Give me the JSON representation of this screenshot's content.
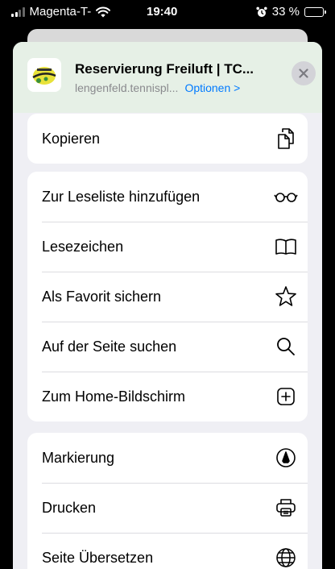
{
  "status_bar": {
    "carrier": "Magenta-T-",
    "time": "19:40",
    "battery": "33 %",
    "battery_level": 0.33
  },
  "share_sheet": {
    "title": "Reservierung Freiluft | TC...",
    "domain": "lengenfeld.tennispl...",
    "options_label": "Optionen >",
    "groups": [
      [
        {
          "label": "Kopieren",
          "icon": "copy-icon"
        }
      ],
      [
        {
          "label": "Zur Leseliste hinzufügen",
          "icon": "glasses-icon"
        },
        {
          "label": "Lesezeichen",
          "icon": "book-icon"
        },
        {
          "label": "Als Favorit sichern",
          "icon": "star-icon"
        },
        {
          "label": "Auf der Seite suchen",
          "icon": "search-icon"
        },
        {
          "label": "Zum Home-Bildschirm",
          "icon": "plus-square-icon"
        }
      ],
      [
        {
          "label": "Markierung",
          "icon": "markup-icon"
        },
        {
          "label": "Drucken",
          "icon": "printer-icon"
        },
        {
          "label": "Seite Übersetzen",
          "icon": "globe-icon"
        }
      ]
    ]
  },
  "colors": {
    "accent": "#007aff",
    "header_background": "#e6f0e6",
    "sheet_background": "#efeff4"
  }
}
